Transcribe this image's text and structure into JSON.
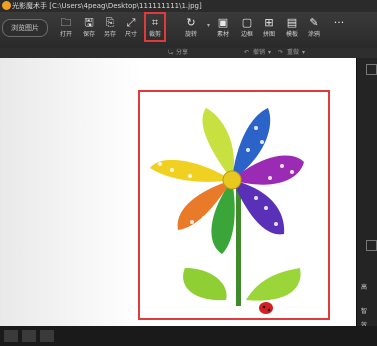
{
  "app": {
    "title": "光影魔术手 [C:\\Users\\4peag\\Desktop\\111111111\\1.jpg]"
  },
  "toolbar": {
    "browse_label": "浏览图片",
    "tools": [
      {
        "label": "打开",
        "icon": "open-icon"
      },
      {
        "label": "保存",
        "icon": "save-icon"
      },
      {
        "label": "另存",
        "icon": "save-as-icon"
      },
      {
        "label": "尺寸",
        "icon": "resize-icon"
      },
      {
        "label": "裁剪",
        "icon": "crop-icon"
      },
      {
        "label": "旋转",
        "icon": "rotate-icon"
      },
      {
        "label": "素材",
        "icon": "material-icon"
      },
      {
        "label": "边框",
        "icon": "border-icon"
      },
      {
        "label": "拼图",
        "icon": "collage-icon"
      },
      {
        "label": "模板",
        "icon": "template-icon"
      },
      {
        "label": "涂鸦",
        "icon": "doodle-icon"
      }
    ],
    "more": "···"
  },
  "subbar": {
    "share": "分享",
    "undo": "撤销",
    "redo": "重做"
  },
  "rightpanel": {
    "labels": [
      "高",
      "智",
      "效"
    ]
  },
  "colors": {
    "highlight": "#e23a3a",
    "toolbar_bg": "#333333"
  }
}
